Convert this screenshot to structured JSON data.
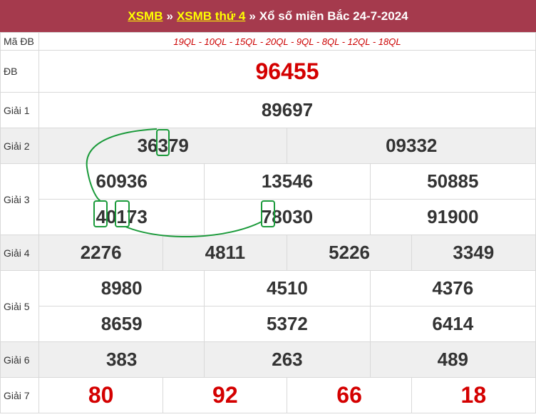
{
  "header": {
    "link1": "XSMB",
    "sep1": "»",
    "link2": "XSMB thứ 4",
    "sep2": "»",
    "title": "Xổ số miền Bắc 24-7-2024"
  },
  "rows": {
    "ma_db": {
      "label": "Mã ĐB",
      "value": "19QL - 10QL - 15QL - 20QL - 9QL - 8QL - 12QL - 18QL"
    },
    "db": {
      "label": "ĐB",
      "value": "96455"
    },
    "g1": {
      "label": "Giải 1",
      "values": [
        "89697"
      ]
    },
    "g2": {
      "label": "Giải 2",
      "values": [
        "36379",
        "09332"
      ]
    },
    "g3": {
      "label": "Giải 3",
      "values": [
        "60936",
        "13546",
        "50885",
        "40173",
        "78030",
        "91900"
      ]
    },
    "g4": {
      "label": "Giải 4",
      "values": [
        "2276",
        "4811",
        "5226",
        "3349"
      ]
    },
    "g5": {
      "label": "Giải 5",
      "values": [
        "8980",
        "4510",
        "4376",
        "8659",
        "5372",
        "6414"
      ]
    },
    "g6": {
      "label": "Giải 6",
      "values": [
        "383",
        "263",
        "489"
      ]
    },
    "g7": {
      "label": "Giải 7",
      "values": [
        "80",
        "92",
        "66",
        "18"
      ]
    }
  },
  "annotation": {
    "color": "#1a9a3a"
  }
}
